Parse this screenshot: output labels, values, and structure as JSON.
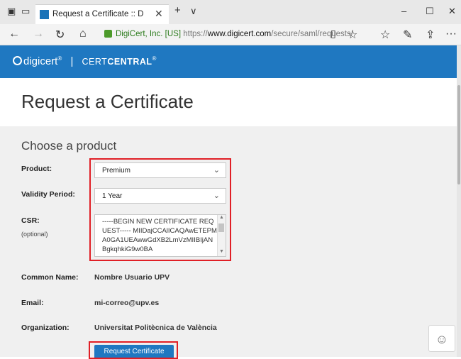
{
  "browser": {
    "tab_title": "Request a Certificate :: D",
    "tab_close": "✕",
    "new_tab": "+",
    "tab_menu": "∨",
    "win_min": "–",
    "win_max": "☐",
    "win_close": "✕",
    "url_org": "DigiCert, Inc. [US]",
    "url_proto": "https://",
    "url_host": "www.digicert.com",
    "url_path": "/secure/saml/requests/",
    "more": "···"
  },
  "header": {
    "brand": "digicert",
    "brand_reg": "®",
    "separator": "|",
    "product_light": "CERT",
    "product_bold": "CENTRAL",
    "product_reg": "®"
  },
  "page": {
    "title": "Request a Certificate",
    "section_title": "Choose a product"
  },
  "form": {
    "product_label": "Product:",
    "product_value": "Premium",
    "validity_label": "Validity Period:",
    "validity_value": "1 Year",
    "csr_label": "CSR:",
    "csr_optional": "(optional)",
    "csr_text": "-----BEGIN NEW CERTIFICATE REQUEST-----\nMIIDajCCAlICAQAwETEPMA0GA1UEAwwGdXB2LmVzMIIBIjANBgkqhkiG9w0BA",
    "common_name_label": "Common Name:",
    "common_name_value": "Nombre Usuario UPV",
    "email_label": "Email:",
    "email_value": "mi-correo@upv.es",
    "organization_label": "Organization:",
    "organization_value": "Universitat Politècnica de València",
    "submit_label": "Request Certificate"
  },
  "icons": {
    "back": "←",
    "forward": "→",
    "refresh": "↻",
    "home": "⌂",
    "star": "☆",
    "favorites": "☆",
    "pen": "✎",
    "share": "⇪",
    "chevron": "⌄",
    "smiley": "☺"
  },
  "colors": {
    "brand_blue": "#1f78c1",
    "highlight_red": "#e01f26",
    "secure_green": "#2a7a1a"
  }
}
